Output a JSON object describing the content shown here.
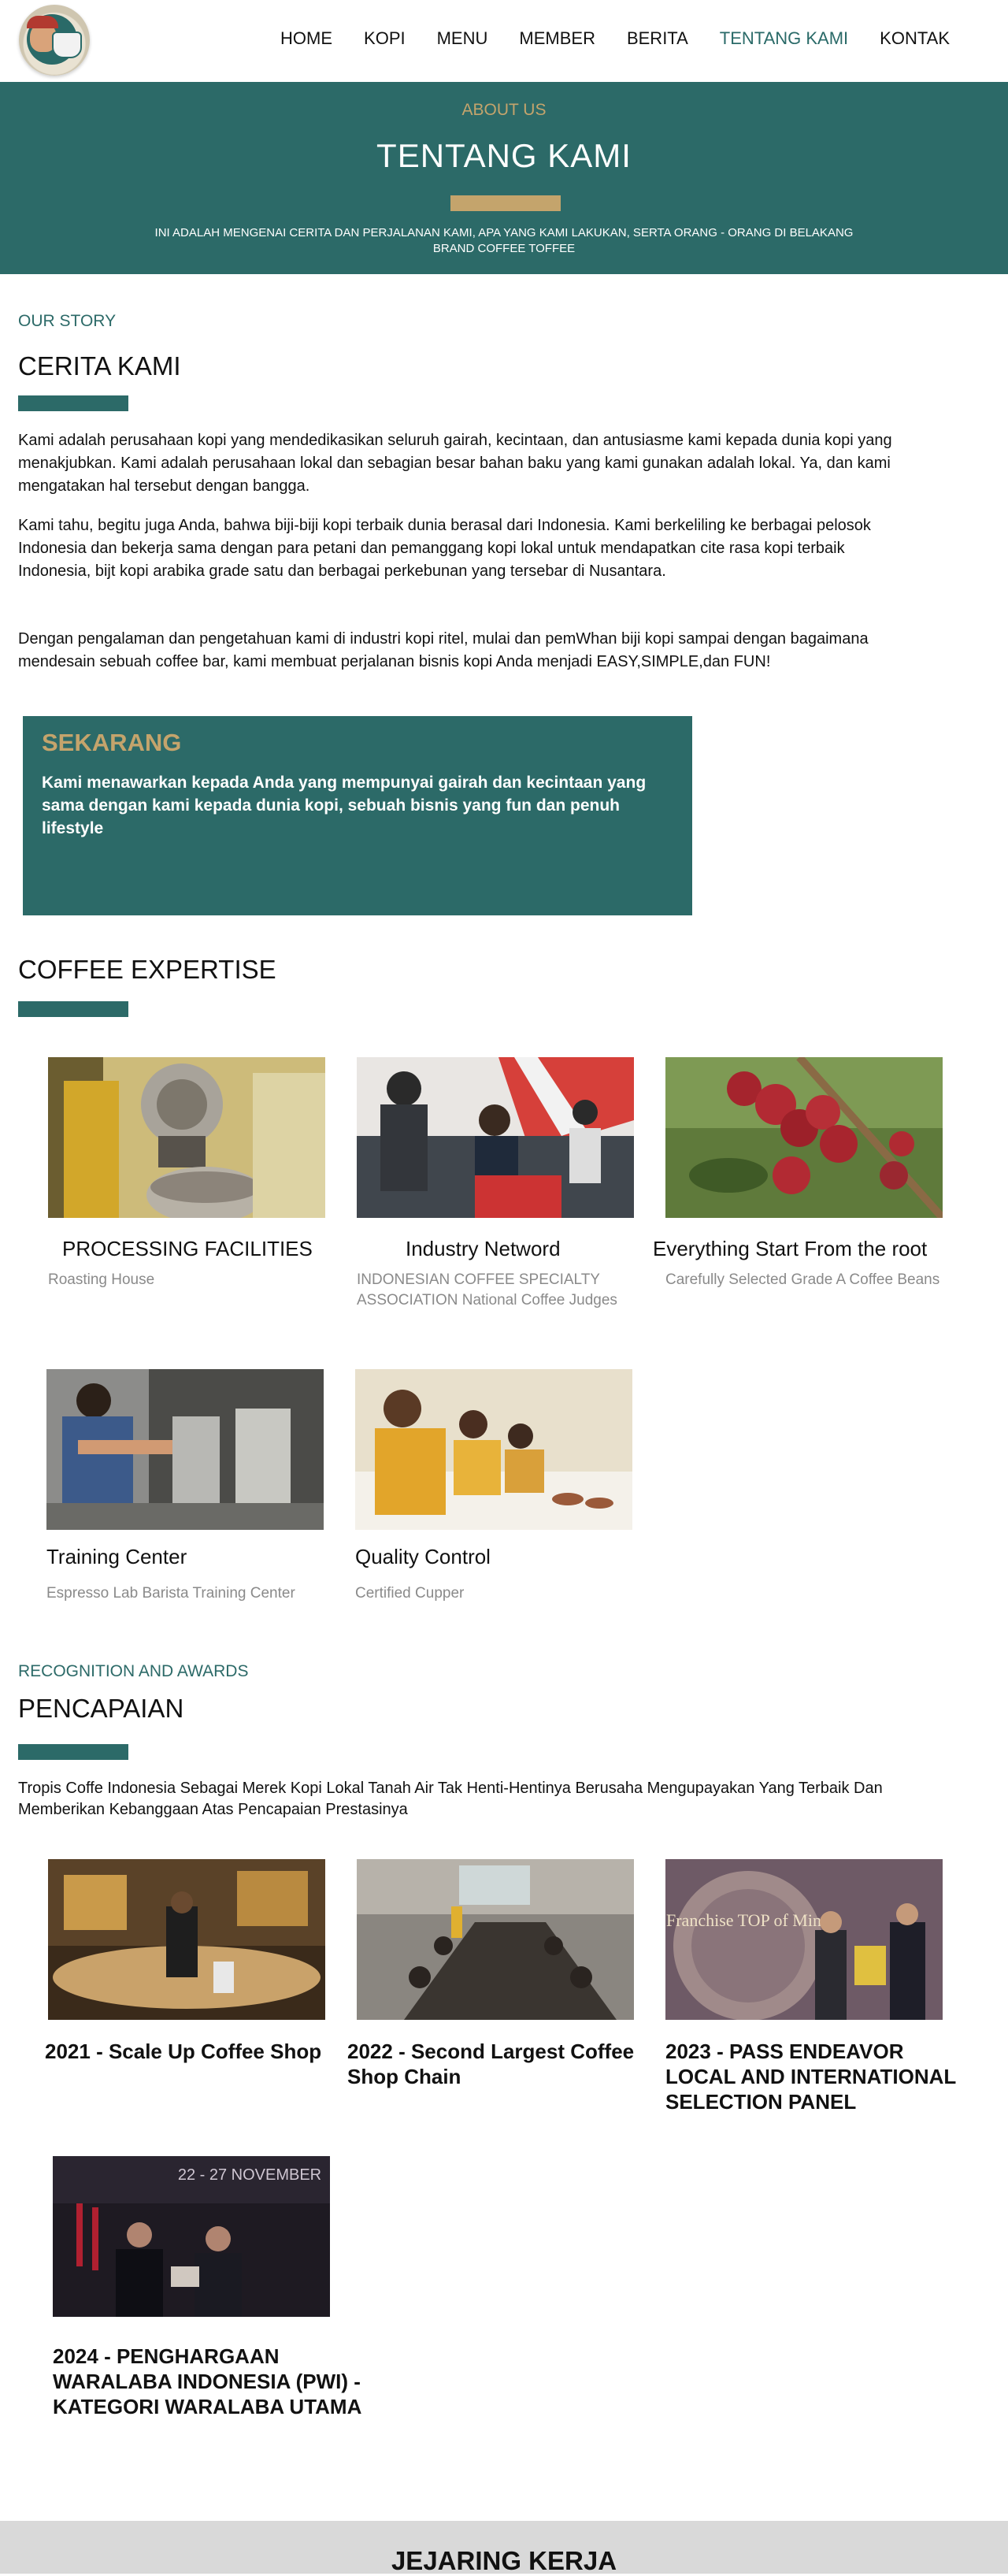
{
  "header": {
    "nav": [
      "HOME",
      "KOPI",
      "MENU",
      "MEMBER",
      "BERITA",
      "TENTANG KAMI",
      "KONTAK"
    ],
    "active_nav": "TENTANG KAMI"
  },
  "hero": {
    "eyebrow": "ABOUT US",
    "title": "TENTANG KAMI",
    "description": "INI ADALAH MENGENAI CERITA DAN PERJALANAN KAMI, APA YANG KAMI LAKUKAN, SERTA ORANG - ORANG DI BELAKANG BRAND COFFEE TOFFEE"
  },
  "story": {
    "eyebrow": "OUR STORY",
    "title": "CERITA KAMI",
    "paragraphs": [
      "Kami adalah perusahaan kopi yang mendedikasikan seluruh gairah, kecintaan, dan antusiasme kami kepada dunia kopi yang menakjubkan. Kami adalah perusahaan lokal dan sebagian besar bahan baku yang kami gunakan adalah lokal. Ya, dan kami mengatakan hal tersebut dengan bangga.",
      "Kami tahu, begitu juga Anda, bahwa biji-biji kopi terbaik dunia berasal dari Indonesia. Kami berkeliling ke berbagai pelosok Indonesia dan bekerja sama dengan para petani dan pemanggang kopi lokal untuk mendapatkan cite rasa kopi terbaik Indonesia, bijt kopi arabika grade satu dan berbagai perkebunan yang tersebar di Nusantara.",
      "Dengan pengalaman dan pengetahuan kami di industri kopi ritel, mulai dan pemWhan biji kopi sampai dengan bagaimana mendesain sebuah coffee bar, kami membuat perjalanan bisnis kopi Anda menjadi EASY,SIMPLE,dan FUN!"
    ],
    "highlight_title": "SEKARANG",
    "highlight_text": "Kami menawarkan kepada Anda yang mempunyai gairah dan kecintaan yang sama dengan kami kepada dunia kopi, sebuah bisnis yang fun dan penuh lifestyle"
  },
  "expertise": {
    "title": "COFFEE EXPERTISE",
    "items": [
      {
        "title": "PROCESSING FACILITIES",
        "subtitle": "Roasting House"
      },
      {
        "title": "Industry Netword",
        "subtitle": "INDONESIAN COFFEE SPECIALTY ASSOCIATION National Coffee Judges"
      },
      {
        "title": "Everything Start From the root",
        "subtitle": "Carefully Selected Grade A Coffee Beans"
      },
      {
        "title": "Training Center",
        "subtitle": "Espresso Lab Barista Training Center"
      },
      {
        "title": "Quality Control",
        "subtitle": "Certified Cupper"
      }
    ]
  },
  "awards": {
    "eyebrow": "RECOGNITION AND AWARDS",
    "title": "PENCAPAIAN",
    "intro": "Tropis Coffe Indonesia Sebagai Merek Kopi Lokal Tanah Air Tak Henti-Hentinya Berusaha Mengupayakan Yang Terbaik Dan Memberikan Kebanggaan Atas Pencapaian Prestasinya",
    "items": [
      {
        "title": "2021 - Scale Up Coffee Shop"
      },
      {
        "title": "2022 - Second Largest Coffee Shop Chain"
      },
      {
        "title": "2023 - PASS ENDEAVOR LOCAL AND INTERNATIONAL SELECTION PANEL"
      },
      {
        "title": "2024 - PENGHARGAAN WARALABA INDONESIA (PWI) - KATEGORI WARALABA UTAMA"
      }
    ],
    "image_texts": {
      "franchise": "Franchise TOP of Mind",
      "event": "22 - 27 NOVEMBER"
    }
  },
  "footer": {
    "title": "JEJARING KERJA"
  },
  "colors": {
    "primary": "#2c6a68",
    "accent": "#c4a46c",
    "footer_bg": "#d9d9d9"
  }
}
